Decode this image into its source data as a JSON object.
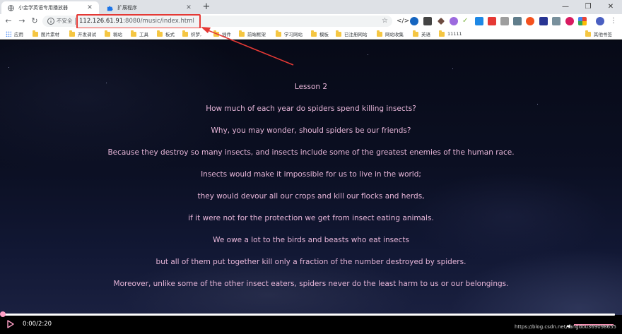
{
  "browser": {
    "tabs": [
      {
        "title": "小金学英语专用播放器",
        "active": true
      },
      {
        "title": "扩展程序",
        "active": false
      }
    ],
    "new_tab": "+",
    "window_controls": {
      "minimize": "—",
      "restore": "❐",
      "close": "✕"
    }
  },
  "toolbar": {
    "back": "←",
    "forward": "→",
    "reload": "↻",
    "security_label": "不安全",
    "url_host": "112.126.61.91",
    "url_rest": ":8080/music/index.html",
    "bookmark_star": "☆"
  },
  "bookmarks": {
    "apps_label": "应用",
    "items": [
      "图片素材",
      "开发调试",
      "稿站",
      "工具",
      "板式",
      "织梦,",
      "插件",
      "前端框架",
      "学习网站",
      "模板",
      "已注册网站",
      "网站收集",
      "英语",
      "11111"
    ],
    "other": "其他书签"
  },
  "lyrics": [
    "Lesson 2",
    "How much of each year do spiders spend killing insects?",
    "Why, you may wonder, should spiders be our friends?",
    "Because they destroy so many insects, and insects include some of the greatest enemies of the human race.",
    "Insects would make it impossible for us to live in the world;",
    "they would devour all our crops and kill our flocks and herds,",
    "if it were not for the protection we get from insect eating animals.",
    "We owe a lot to the birds and beasts who eat insects",
    "but all of them put together kill only a fraction of the number destroyed by spiders.",
    "Moreover, unlike some of the other insect eaters, spiders never do the least harm to us or our belongings."
  ],
  "player": {
    "time": "0:00/2:20",
    "progress": 0,
    "volume": 1.0,
    "accent": "#ff9fc6"
  },
  "watermark": "https://blog.csdn.net/tangdou369098655",
  "colors": {
    "lyric_text": "#e7b6d9",
    "highlight": "#e53935"
  }
}
